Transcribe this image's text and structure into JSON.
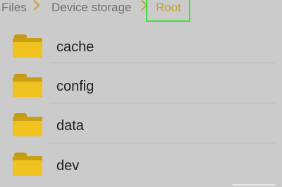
{
  "breadcrumb": {
    "items": [
      "Files",
      "Device storage",
      "Root"
    ]
  },
  "files": [
    {
      "name": "cache",
      "icon": "folder-icon"
    },
    {
      "name": "config",
      "icon": "folder-icon"
    },
    {
      "name": "data",
      "icon": "folder-icon"
    },
    {
      "name": "dev",
      "icon": "folder-icon"
    }
  ],
  "colors": {
    "accent": "#c9a02a",
    "folder": "#f0c220",
    "highlight": "#3fe03f",
    "background": "#cbcbcb"
  }
}
